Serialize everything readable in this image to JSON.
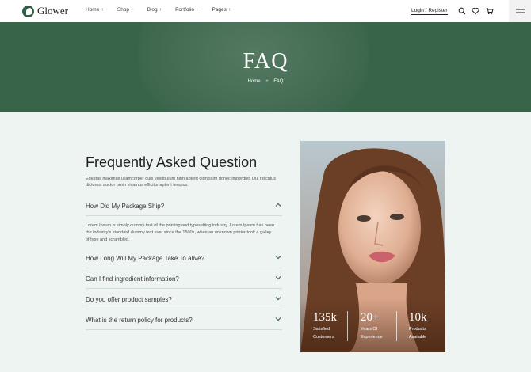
{
  "header": {
    "logo_text": "Glower",
    "nav": [
      {
        "label": "Home"
      },
      {
        "label": "Shop"
      },
      {
        "label": "Blog"
      },
      {
        "label": "Portfolio"
      },
      {
        "label": "Pages"
      }
    ],
    "login_label": "Login / Register",
    "icons": [
      "search-icon",
      "heart-icon",
      "cart-icon",
      "menu-icon"
    ]
  },
  "hero": {
    "title": "FAQ",
    "breadcrumb": {
      "home": "Home",
      "separator": "+",
      "current": "FAQ"
    }
  },
  "faq": {
    "title": "Frequently Asked Question",
    "description": "Egestas maximus ullamcorper quis vestibulum nibh aptent dignissim donec imperdiet. Dui ridiculus dictumst auctor proin vivamus efficitur aptent tempus.",
    "items": [
      {
        "question": "How Did My Package Ship?",
        "expanded": true,
        "answer": "Lorem Ipsum is simply dummy text of the printing and typesetting industry. Lorem Ipsum has been the industry's standard dummy text ever since the 1500s, when an unknown printer took a galley of type and scrambled."
      },
      {
        "question": "How Long Will My Package Take To alive?",
        "expanded": false
      },
      {
        "question": "Can I find ingredient information?",
        "expanded": false
      },
      {
        "question": "Do you offer product samples?",
        "expanded": false
      },
      {
        "question": "What is the return policy for products?",
        "expanded": false
      }
    ]
  },
  "stats": [
    {
      "number": "135k",
      "label_line1": "Satisfied",
      "label_line2": "Customers"
    },
    {
      "number": "20+",
      "label_line1": "Years Of",
      "label_line2": "Experience"
    },
    {
      "number": "10k",
      "label_line1": "Products",
      "label_line2": "Available"
    }
  ],
  "colors": {
    "accent": "#3d6a50",
    "background": "#eef4f1"
  }
}
